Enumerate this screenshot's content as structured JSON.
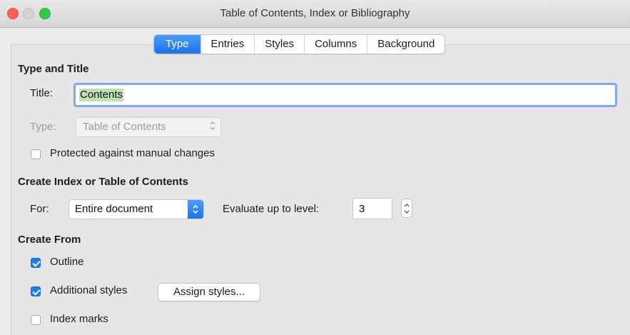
{
  "window": {
    "title": "Table of Contents, Index or Bibliography"
  },
  "tabs": [
    {
      "label": "Type",
      "active": true
    },
    {
      "label": "Entries",
      "active": false
    },
    {
      "label": "Styles",
      "active": false
    },
    {
      "label": "Columns",
      "active": false
    },
    {
      "label": "Background",
      "active": false
    }
  ],
  "type_and_title": {
    "heading": "Type and Title",
    "title_label": "Title:",
    "title_value": "Contents",
    "type_label": "Type:",
    "type_value": "Table of Contents",
    "protected_label": "Protected against manual changes",
    "protected_checked": false
  },
  "create_index": {
    "heading": "Create Index or Table of Contents",
    "for_label": "For:",
    "for_value": "Entire document",
    "evaluate_label": "Evaluate up to level:",
    "evaluate_value": "3"
  },
  "create_from": {
    "heading": "Create From",
    "outline_label": "Outline",
    "outline_checked": true,
    "additional_label": "Additional styles",
    "additional_checked": true,
    "assign_button": "Assign styles...",
    "index_marks_label": "Index marks",
    "index_marks_checked": false
  },
  "colors": {
    "accent": "#1a73e8",
    "focus_ring": "#7eaaf5",
    "close": "#fc605c",
    "maximize": "#34c84a"
  }
}
